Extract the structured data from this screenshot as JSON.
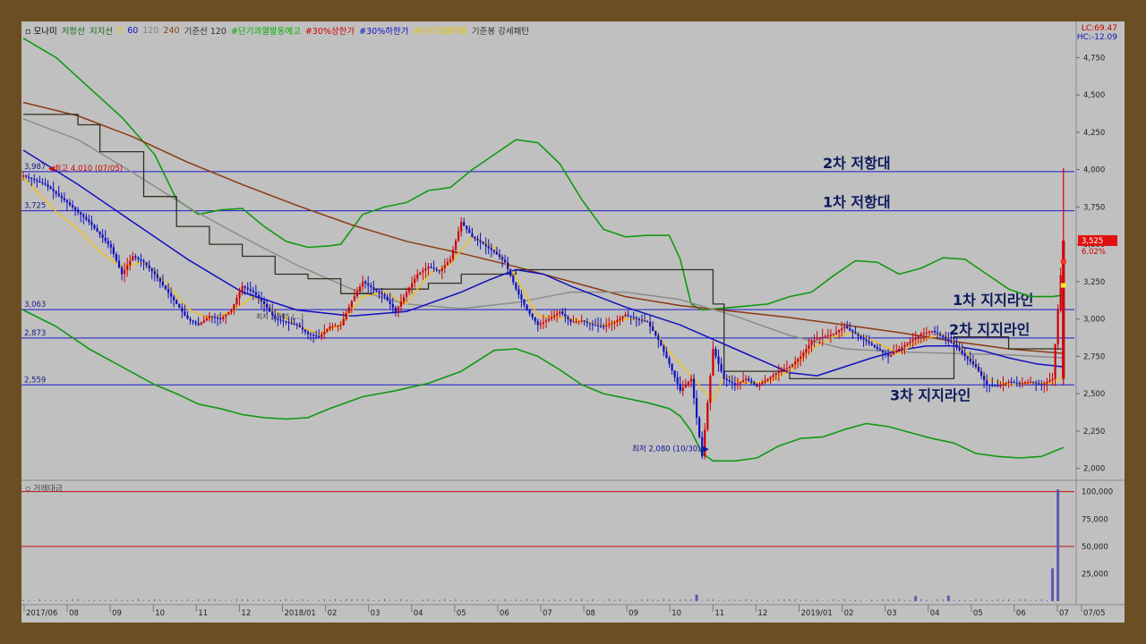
{
  "legend": {
    "items": [
      {
        "text": "모나미",
        "color": "#000000"
      },
      {
        "text": "저항선",
        "color": "#1a6b1a"
      },
      {
        "text": "지지선",
        "color": "#1a6b1a"
      },
      {
        "text": "5",
        "color": "#e6c200"
      },
      {
        "text": "60",
        "color": "#1010c0"
      },
      {
        "text": "120",
        "color": "#808080"
      },
      {
        "text": "240",
        "color": "#8b4513"
      },
      {
        "text": "기준선 120",
        "color": "#333333"
      },
      {
        "text": "#단기과열발동예고",
        "color": "#00b000"
      },
      {
        "text": "#30%상한가",
        "color": "#d00000"
      },
      {
        "text": "#30%하한가",
        "color": "#1010c0"
      },
      {
        "text": "#단기과열적용",
        "color": "#e6c200"
      },
      {
        "text": "기준봉 강세패턴",
        "color": "#333333"
      }
    ]
  },
  "corner": {
    "lc": "LC:69.47",
    "hc": "HC:-12.09"
  },
  "volume_title": "거래대금",
  "colors": {
    "up": "#d00000",
    "down": "#1010c0",
    "ma5": "#f0c020",
    "ma60": "#1010c0",
    "ma120": "#8c8c8c",
    "ma240": "#8b3a10",
    "base": "#333020",
    "band": "#119911",
    "hline": "#1a1acc"
  },
  "chart_data": {
    "type": "line",
    "x_ticks": [
      "2017/06",
      "08",
      "09",
      "10",
      "11",
      "12",
      "2018/01",
      "02",
      "03",
      "04",
      "05",
      "06",
      "07",
      "08",
      "09",
      "10",
      "11",
      "12",
      "2019/01",
      "02",
      "03",
      "04",
      "05",
      "06",
      "07",
      "07/05"
    ],
    "y_ticks": [
      "4,750",
      "4,500",
      "4,250",
      "4,000",
      "3,750",
      "3,500",
      "3,250",
      "3,000",
      "2,750",
      "2,500",
      "2,250",
      "2,000"
    ],
    "ylim": [
      1950,
      4920
    ],
    "volume_ticks": [
      "100,000",
      "75,000",
      "50,000",
      "25,000"
    ],
    "volume_ylim": [
      0,
      103000
    ],
    "horizontal_levels": [
      {
        "value": 3987,
        "left_label": "3,987",
        "right_label": "2차 저항대"
      },
      {
        "value": 3725,
        "left_label": "3,725",
        "right_label": "1차 저항대"
      },
      {
        "value": 3063,
        "left_label": "3,063",
        "right_label": "1차 지지라인"
      },
      {
        "value": 2873,
        "left_label": "2,873",
        "right_label": "2차 지지라인"
      },
      {
        "value": 2559,
        "left_label": "2,559",
        "right_label": "3차 지지라인"
      }
    ],
    "annotations": {
      "high": {
        "text": "최고 4,010 (07/05)",
        "value": 4010
      },
      "low": {
        "text": "최저 2,080 (10/30)",
        "value": 2080
      },
      "mid": "최저 2,785 (...)",
      "last_price": "3,525",
      "last_change": "6.02%"
    },
    "price_path": [
      [
        0,
        3960
      ],
      [
        4,
        3900
      ],
      [
        8,
        3780
      ],
      [
        12,
        3650
      ],
      [
        16,
        3480
      ],
      [
        18,
        3300
      ],
      [
        20,
        3420
      ],
      [
        22,
        3380
      ],
      [
        24,
        3300
      ],
      [
        26,
        3200
      ],
      [
        28,
        3100
      ],
      [
        30,
        3000
      ],
      [
        32,
        2960
      ],
      [
        34,
        3020
      ],
      [
        36,
        3000
      ],
      [
        38,
        3060
      ],
      [
        40,
        3220
      ],
      [
        42,
        3180
      ],
      [
        44,
        3100
      ],
      [
        46,
        3000
      ],
      [
        48,
        2980
      ],
      [
        50,
        2960
      ],
      [
        52,
        2900
      ],
      [
        54,
        2880
      ],
      [
        56,
        2950
      ],
      [
        58,
        2960
      ],
      [
        60,
        3120
      ],
      [
        62,
        3250
      ],
      [
        64,
        3200
      ],
      [
        66,
        3150
      ],
      [
        68,
        3050
      ],
      [
        70,
        3180
      ],
      [
        72,
        3300
      ],
      [
        74,
        3350
      ],
      [
        76,
        3320
      ],
      [
        78,
        3400
      ],
      [
        80,
        3650
      ],
      [
        82,
        3550
      ],
      [
        84,
        3500
      ],
      [
        86,
        3450
      ],
      [
        88,
        3380
      ],
      [
        90,
        3200
      ],
      [
        92,
        3060
      ],
      [
        94,
        2960
      ],
      [
        96,
        3000
      ],
      [
        98,
        3050
      ],
      [
        100,
        2980
      ],
      [
        102,
        2990
      ],
      [
        104,
        2960
      ],
      [
        106,
        2950
      ],
      [
        108,
        2980
      ],
      [
        110,
        3030
      ],
      [
        112,
        3000
      ],
      [
        114,
        2980
      ],
      [
        116,
        2860
      ],
      [
        118,
        2700
      ],
      [
        120,
        2520
      ],
      [
        122,
        2600
      ],
      [
        124,
        2080
      ],
      [
        126,
        2800
      ],
      [
        128,
        2600
      ],
      [
        130,
        2560
      ],
      [
        132,
        2600
      ],
      [
        134,
        2550
      ],
      [
        136,
        2600
      ],
      [
        138,
        2650
      ],
      [
        140,
        2680
      ],
      [
        142,
        2750
      ],
      [
        144,
        2850
      ],
      [
        146,
        2880
      ],
      [
        148,
        2900
      ],
      [
        150,
        2950
      ],
      [
        152,
        2900
      ],
      [
        154,
        2850
      ],
      [
        156,
        2800
      ],
      [
        158,
        2750
      ],
      [
        160,
        2800
      ],
      [
        162,
        2850
      ],
      [
        164,
        2900
      ],
      [
        166,
        2920
      ],
      [
        168,
        2880
      ],
      [
        170,
        2830
      ],
      [
        172,
        2750
      ],
      [
        174,
        2680
      ],
      [
        176,
        2560
      ],
      [
        178,
        2550
      ],
      [
        180,
        2580
      ],
      [
        182,
        2570
      ],
      [
        184,
        2580
      ],
      [
        186,
        2560
      ],
      [
        188,
        2600
      ],
      [
        190,
        3525
      ]
    ],
    "ma5": [
      [
        0,
        3950
      ],
      [
        6,
        3720
      ],
      [
        10,
        3600
      ],
      [
        14,
        3450
      ],
      [
        18,
        3350
      ],
      [
        22,
        3380
      ],
      [
        26,
        3250
      ],
      [
        30,
        3070
      ],
      [
        34,
        3000
      ],
      [
        38,
        3050
      ],
      [
        42,
        3150
      ],
      [
        46,
        3050
      ],
      [
        50,
        2960
      ],
      [
        54,
        2900
      ],
      [
        58,
        2960
      ],
      [
        62,
        3150
      ],
      [
        66,
        3180
      ],
      [
        70,
        3100
      ],
      [
        74,
        3300
      ],
      [
        78,
        3370
      ],
      [
        82,
        3550
      ],
      [
        86,
        3480
      ],
      [
        90,
        3280
      ],
      [
        94,
        3020
      ],
      [
        98,
        3010
      ],
      [
        102,
        2990
      ],
      [
        106,
        2960
      ],
      [
        110,
        3000
      ],
      [
        114,
        2990
      ],
      [
        118,
        2780
      ],
      [
        122,
        2620
      ],
      [
        126,
        2450
      ],
      [
        128,
        2620
      ],
      [
        132,
        2570
      ],
      [
        136,
        2580
      ],
      [
        140,
        2650
      ],
      [
        144,
        2800
      ],
      [
        148,
        2880
      ],
      [
        152,
        2910
      ],
      [
        156,
        2840
      ],
      [
        160,
        2770
      ],
      [
        164,
        2860
      ],
      [
        168,
        2900
      ],
      [
        172,
        2790
      ],
      [
        176,
        2600
      ],
      [
        180,
        2560
      ],
      [
        184,
        2570
      ],
      [
        188,
        2570
      ],
      [
        190,
        2620
      ]
    ],
    "ma60": [
      [
        0,
        4130
      ],
      [
        10,
        3900
      ],
      [
        20,
        3650
      ],
      [
        30,
        3400
      ],
      [
        40,
        3180
      ],
      [
        50,
        3060
      ],
      [
        60,
        3020
      ],
      [
        70,
        3050
      ],
      [
        80,
        3180
      ],
      [
        85,
        3260
      ],
      [
        90,
        3330
      ],
      [
        95,
        3300
      ],
      [
        100,
        3220
      ],
      [
        105,
        3150
      ],
      [
        110,
        3080
      ],
      [
        115,
        3020
      ],
      [
        120,
        2960
      ],
      [
        125,
        2880
      ],
      [
        130,
        2800
      ],
      [
        135,
        2720
      ],
      [
        140,
        2640
      ],
      [
        145,
        2620
      ],
      [
        150,
        2680
      ],
      [
        155,
        2740
      ],
      [
        160,
        2790
      ],
      [
        165,
        2820
      ],
      [
        170,
        2820
      ],
      [
        175,
        2790
      ],
      [
        180,
        2740
      ],
      [
        185,
        2700
      ],
      [
        190,
        2680
      ]
    ],
    "ma120": [
      [
        0,
        4340
      ],
      [
        10,
        4200
      ],
      [
        20,
        3980
      ],
      [
        30,
        3750
      ],
      [
        40,
        3550
      ],
      [
        50,
        3360
      ],
      [
        60,
        3200
      ],
      [
        70,
        3100
      ],
      [
        80,
        3070
      ],
      [
        90,
        3110
      ],
      [
        100,
        3180
      ],
      [
        110,
        3180
      ],
      [
        120,
        3130
      ],
      [
        130,
        3020
      ],
      [
        140,
        2890
      ],
      [
        150,
        2800
      ],
      [
        160,
        2780
      ],
      [
        170,
        2770
      ],
      [
        180,
        2760
      ],
      [
        190,
        2740
      ]
    ],
    "ma240": [
      [
        0,
        4450
      ],
      [
        10,
        4360
      ],
      [
        20,
        4220
      ],
      [
        30,
        4050
      ],
      [
        40,
        3900
      ],
      [
        50,
        3760
      ],
      [
        60,
        3630
      ],
      [
        70,
        3520
      ],
      [
        80,
        3440
      ],
      [
        90,
        3350
      ],
      [
        100,
        3250
      ],
      [
        110,
        3150
      ],
      [
        120,
        3090
      ],
      [
        130,
        3050
      ],
      [
        140,
        3010
      ],
      [
        150,
        2960
      ],
      [
        160,
        2910
      ],
      [
        170,
        2850
      ],
      [
        180,
        2800
      ],
      [
        190,
        2770
      ]
    ],
    "base_line": [
      [
        0,
        4370
      ],
      [
        10,
        4370
      ],
      [
        10,
        4300
      ],
      [
        14,
        4300
      ],
      [
        14,
        4120
      ],
      [
        22,
        4120
      ],
      [
        22,
        3820
      ],
      [
        28,
        3820
      ],
      [
        28,
        3620
      ],
      [
        34,
        3620
      ],
      [
        34,
        3500
      ],
      [
        40,
        3500
      ],
      [
        40,
        3420
      ],
      [
        46,
        3420
      ],
      [
        46,
        3300
      ],
      [
        52,
        3300
      ],
      [
        52,
        3270
      ],
      [
        58,
        3270
      ],
      [
        58,
        3170
      ],
      [
        64,
        3170
      ],
      [
        64,
        3200
      ],
      [
        74,
        3200
      ],
      [
        74,
        3240
      ],
      [
        80,
        3240
      ],
      [
        80,
        3300
      ],
      [
        90,
        3300
      ],
      [
        90,
        3330
      ],
      [
        100,
        3330
      ],
      [
        100,
        3330
      ],
      [
        112,
        3330
      ],
      [
        112,
        3330
      ],
      [
        124,
        3330
      ],
      [
        124,
        3330
      ],
      [
        126,
        3330
      ],
      [
        126,
        3100
      ],
      [
        128,
        3100
      ],
      [
        128,
        2650
      ],
      [
        140,
        2650
      ],
      [
        140,
        2600
      ],
      [
        160,
        2600
      ],
      [
        160,
        2600
      ],
      [
        170,
        2600
      ],
      [
        170,
        2880
      ],
      [
        180,
        2880
      ],
      [
        180,
        2800
      ],
      [
        190,
        2800
      ]
    ],
    "upper_band": [
      [
        0,
        4880
      ],
      [
        6,
        4750
      ],
      [
        12,
        4550
      ],
      [
        18,
        4350
      ],
      [
        24,
        4100
      ],
      [
        28,
        3800
      ],
      [
        32,
        3700
      ],
      [
        36,
        3730
      ],
      [
        40,
        3740
      ],
      [
        44,
        3620
      ],
      [
        48,
        3520
      ],
      [
        52,
        3480
      ],
      [
        56,
        3490
      ],
      [
        58,
        3500
      ],
      [
        62,
        3700
      ],
      [
        66,
        3750
      ],
      [
        70,
        3780
      ],
      [
        74,
        3860
      ],
      [
        78,
        3880
      ],
      [
        82,
        4000
      ],
      [
        86,
        4100
      ],
      [
        90,
        4200
      ],
      [
        94,
        4180
      ],
      [
        98,
        4040
      ],
      [
        102,
        3800
      ],
      [
        106,
        3600
      ],
      [
        110,
        3550
      ],
      [
        114,
        3560
      ],
      [
        118,
        3560
      ],
      [
        120,
        3400
      ],
      [
        122,
        3100
      ],
      [
        124,
        3060
      ],
      [
        130,
        3080
      ],
      [
        136,
        3100
      ],
      [
        140,
        3150
      ],
      [
        144,
        3180
      ],
      [
        148,
        3290
      ],
      [
        152,
        3390
      ],
      [
        156,
        3380
      ],
      [
        160,
        3300
      ],
      [
        164,
        3340
      ],
      [
        168,
        3410
      ],
      [
        172,
        3400
      ],
      [
        176,
        3300
      ],
      [
        180,
        3200
      ],
      [
        184,
        3150
      ],
      [
        188,
        3150
      ],
      [
        190,
        3160
      ]
    ],
    "lower_band": [
      [
        0,
        3060
      ],
      [
        6,
        2950
      ],
      [
        12,
        2800
      ],
      [
        18,
        2680
      ],
      [
        24,
        2560
      ],
      [
        28,
        2500
      ],
      [
        32,
        2430
      ],
      [
        36,
        2400
      ],
      [
        40,
        2360
      ],
      [
        44,
        2340
      ],
      [
        48,
        2330
      ],
      [
        52,
        2340
      ],
      [
        56,
        2400
      ],
      [
        62,
        2480
      ],
      [
        68,
        2520
      ],
      [
        74,
        2570
      ],
      [
        80,
        2650
      ],
      [
        86,
        2790
      ],
      [
        90,
        2800
      ],
      [
        94,
        2750
      ],
      [
        98,
        2660
      ],
      [
        102,
        2560
      ],
      [
        106,
        2500
      ],
      [
        110,
        2470
      ],
      [
        114,
        2440
      ],
      [
        118,
        2400
      ],
      [
        120,
        2350
      ],
      [
        122,
        2250
      ],
      [
        124,
        2100
      ],
      [
        126,
        2050
      ],
      [
        130,
        2050
      ],
      [
        134,
        2070
      ],
      [
        138,
        2150
      ],
      [
        142,
        2200
      ],
      [
        146,
        2210
      ],
      [
        150,
        2260
      ],
      [
        154,
        2300
      ],
      [
        158,
        2280
      ],
      [
        162,
        2240
      ],
      [
        166,
        2200
      ],
      [
        170,
        2170
      ],
      [
        174,
        2100
      ],
      [
        178,
        2080
      ],
      [
        182,
        2070
      ],
      [
        186,
        2080
      ],
      [
        190,
        2140
      ]
    ],
    "volume_spikes": [
      [
        123,
        6000
      ],
      [
        163,
        4500
      ],
      [
        169,
        5000
      ],
      [
        188,
        30000
      ],
      [
        189,
        102000
      ]
    ]
  }
}
